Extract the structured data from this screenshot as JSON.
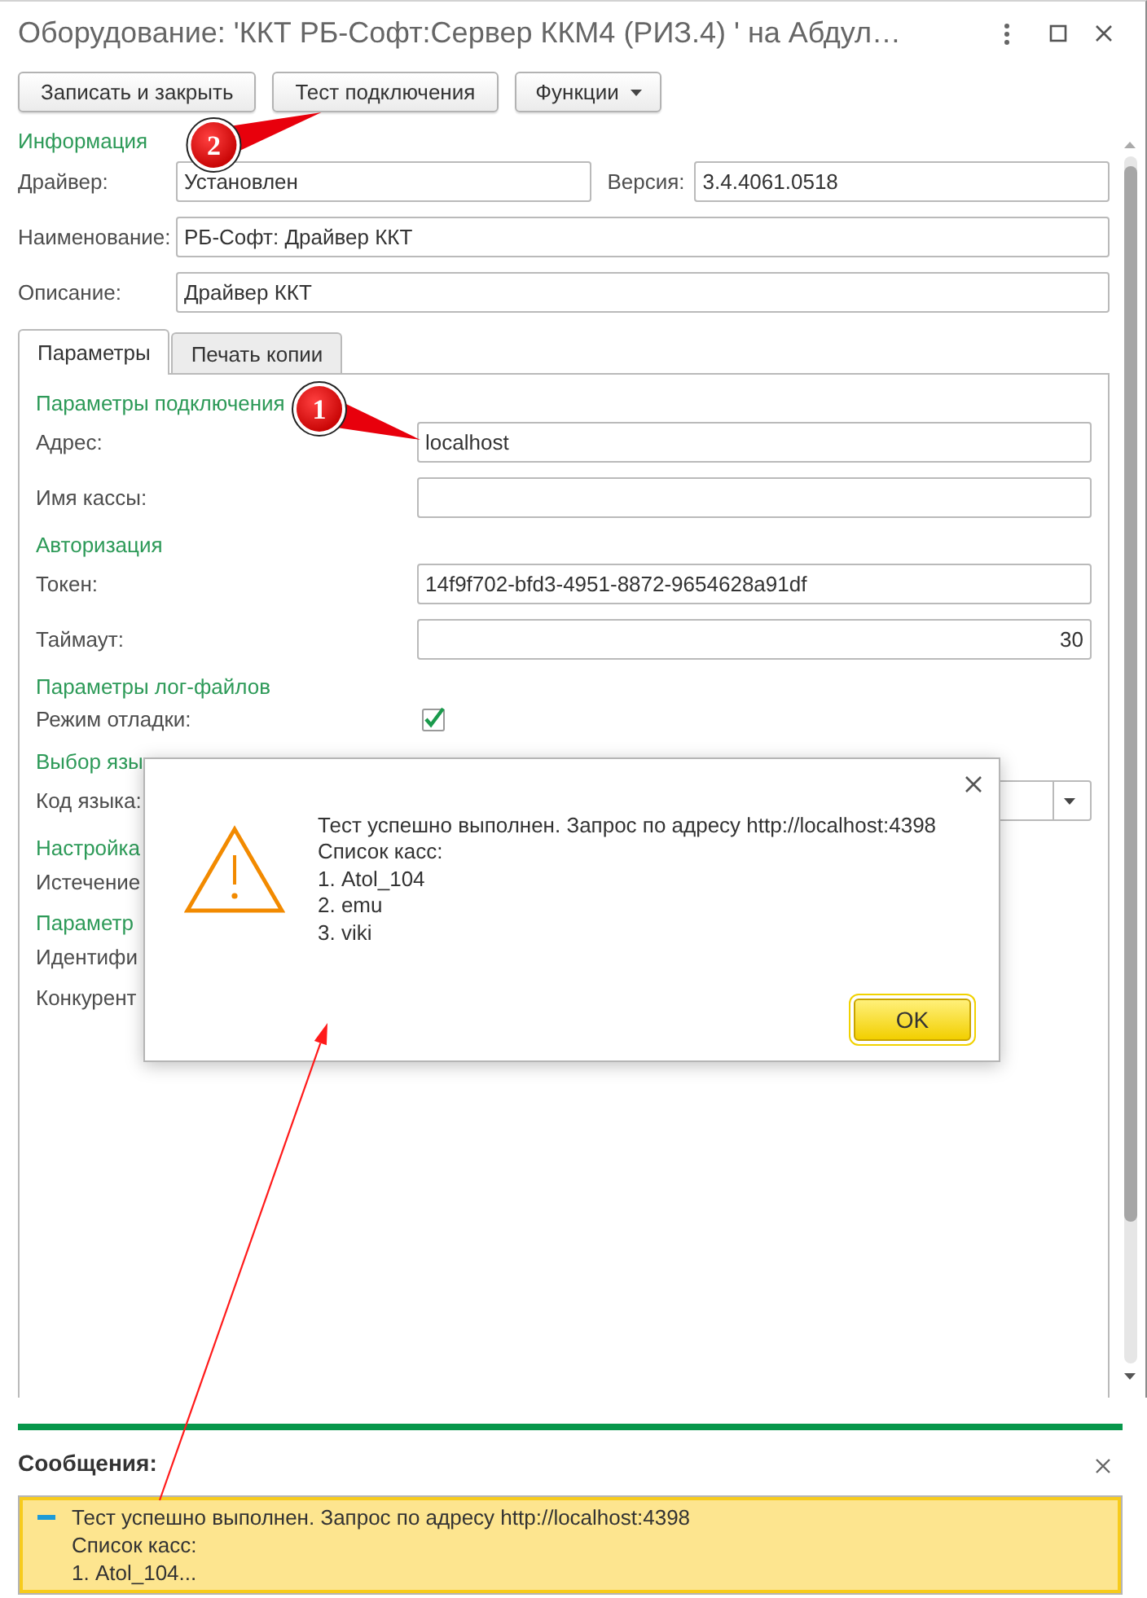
{
  "window": {
    "title": "Оборудование: 'ККТ РБ-Софт:Сервер ККМ4 (РИЗ.4) ' на Абдул…"
  },
  "toolbar": [
    {
      "kind": "button",
      "label": "Записать и закрыть"
    },
    {
      "kind": "button",
      "label": "Тест подключения",
      "callout": "2"
    },
    {
      "kind": "menu",
      "label": "Функции"
    }
  ],
  "info": {
    "title": "Информация",
    "rows": [
      [
        {
          "label": "Драйвер:",
          "value": "Установлен"
        },
        {
          "label": "Версия:",
          "value": "3.4.4061.0518"
        }
      ],
      [
        {
          "label": "Наименование:",
          "value": "РБ-Софт: Драйвер ККТ"
        }
      ],
      [
        {
          "label": "Описание:",
          "value": "Драйвер ККТ"
        }
      ]
    ]
  },
  "tabs": [
    {
      "label": "Параметры",
      "selected": true
    },
    {
      "label": "Печать копии",
      "selected": false
    }
  ],
  "panel": {
    "rows": [
      {
        "kind": "header",
        "text": "Параметры подключения"
      },
      {
        "kind": "text",
        "label": "Адрес:",
        "value": "localhost",
        "callout": "1"
      },
      {
        "kind": "text",
        "label": "Имя кассы:"
      },
      {
        "kind": "header",
        "text": "Авторизация"
      },
      {
        "kind": "text",
        "label": "Токен:",
        "value": "14f9f702-bfd3-4951-8872-9654628a91df"
      },
      {
        "kind": "number",
        "label": "Таймаут:",
        "value": "30"
      },
      {
        "kind": "header",
        "text": "Параметры лог-файлов"
      },
      {
        "kind": "checkbox",
        "label": "Режим отладки:",
        "checked": true
      },
      {
        "kind": "header",
        "text": "Выбор язы"
      },
      {
        "kind": "select",
        "label": "Код языка:"
      },
      {
        "kind": "header",
        "text": "Настройка"
      },
      {
        "kind": "label",
        "label": "Истечение"
      },
      {
        "kind": "header",
        "text": "Параметр"
      },
      {
        "kind": "label",
        "label": "Идентифи"
      },
      {
        "kind": "label",
        "label": "Конкурент"
      }
    ]
  },
  "dialog": {
    "message": "Тест успешно выполнен. Запрос по адресу http://localhost:4398\nСписок касс:\n1. Atol_104\n2. emu\n3. viki",
    "button": "OK"
  },
  "messages": {
    "title": "Сообщения:",
    "items": [
      {
        "text": "Тест успешно выполнен. Запрос по адресу http://localhost:4398\nСписок касс:\n1. Atol_104..."
      }
    ]
  }
}
